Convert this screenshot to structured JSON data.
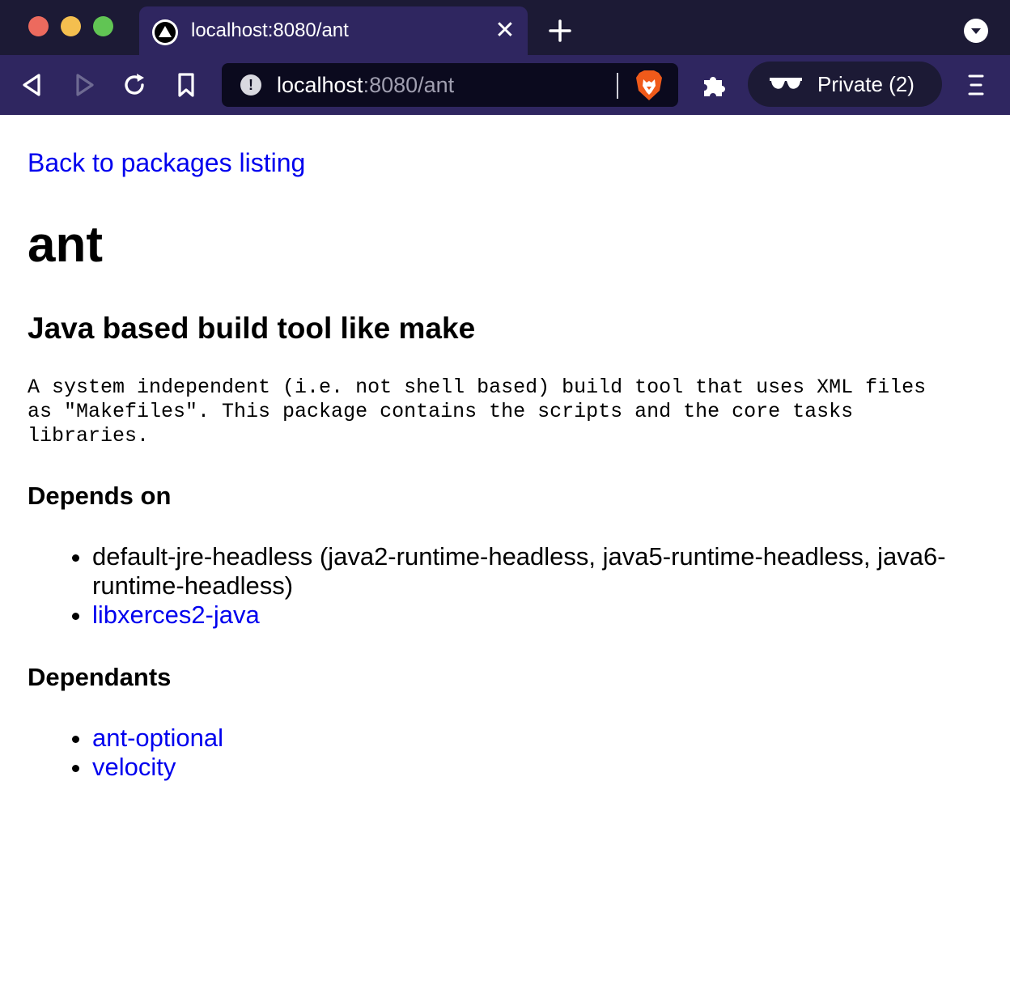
{
  "tab": {
    "title": "localhost:8080/ant",
    "close_symbol": "✕"
  },
  "toolbar": {
    "url_host": "localhost",
    "url_rest": ":8080/ant",
    "private_label": "Private (2)"
  },
  "icons": {
    "back": "back-icon",
    "forward": "forward-icon",
    "reload": "reload-icon",
    "bookmark": "bookmark-icon",
    "site_info": "info-icon",
    "brave": "brave-shield-icon",
    "extensions": "puzzle-icon",
    "private": "sunglasses-icon",
    "menu": "hamburger-icon"
  },
  "colors": {
    "link": "#0000ee",
    "chrome_dark": "#1c1a35",
    "chrome_purple": "#2f2660",
    "brave_orange": "#f05a1a"
  },
  "page": {
    "back_link": "Back to packages listing",
    "package_name": "ant",
    "summary": "Java based build tool like make",
    "description": "A system independent (i.e. not shell based) build tool that uses XML files\nas \"Makefiles\". This package contains the scripts and the core tasks\nlibraries.",
    "depends_heading": "Depends on",
    "depends": [
      {
        "text": "default-jre-headless (java2-runtime-headless, java5-runtime-headless, java6-runtime-headless)",
        "link": false
      },
      {
        "text": "libxerces2-java",
        "link": true
      }
    ],
    "dependants_heading": "Dependants",
    "dependants": [
      {
        "text": "ant-optional",
        "link": true
      },
      {
        "text": "velocity",
        "link": true
      }
    ]
  }
}
